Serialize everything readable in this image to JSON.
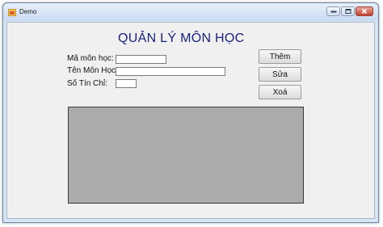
{
  "window": {
    "title": "Demo",
    "controls": [
      "minimize",
      "maximize",
      "close"
    ]
  },
  "form": {
    "heading": "QUẢN LÝ MÔN HỌC",
    "fields": {
      "ma_mon_hoc": {
        "label": "Mã môn học:",
        "value": ""
      },
      "ten_mon_hoc": {
        "label": "Tên Môn Học:",
        "value": ""
      },
      "so_tin_chi": {
        "label": "Số Tín Chỉ:",
        "value": ""
      }
    },
    "buttons": {
      "add": "Thêm",
      "edit": "Sửa",
      "delete": "Xoá"
    }
  },
  "colors": {
    "heading": "#1a237e",
    "grid_background": "#ababab",
    "form_background": "#f0f0f0"
  }
}
